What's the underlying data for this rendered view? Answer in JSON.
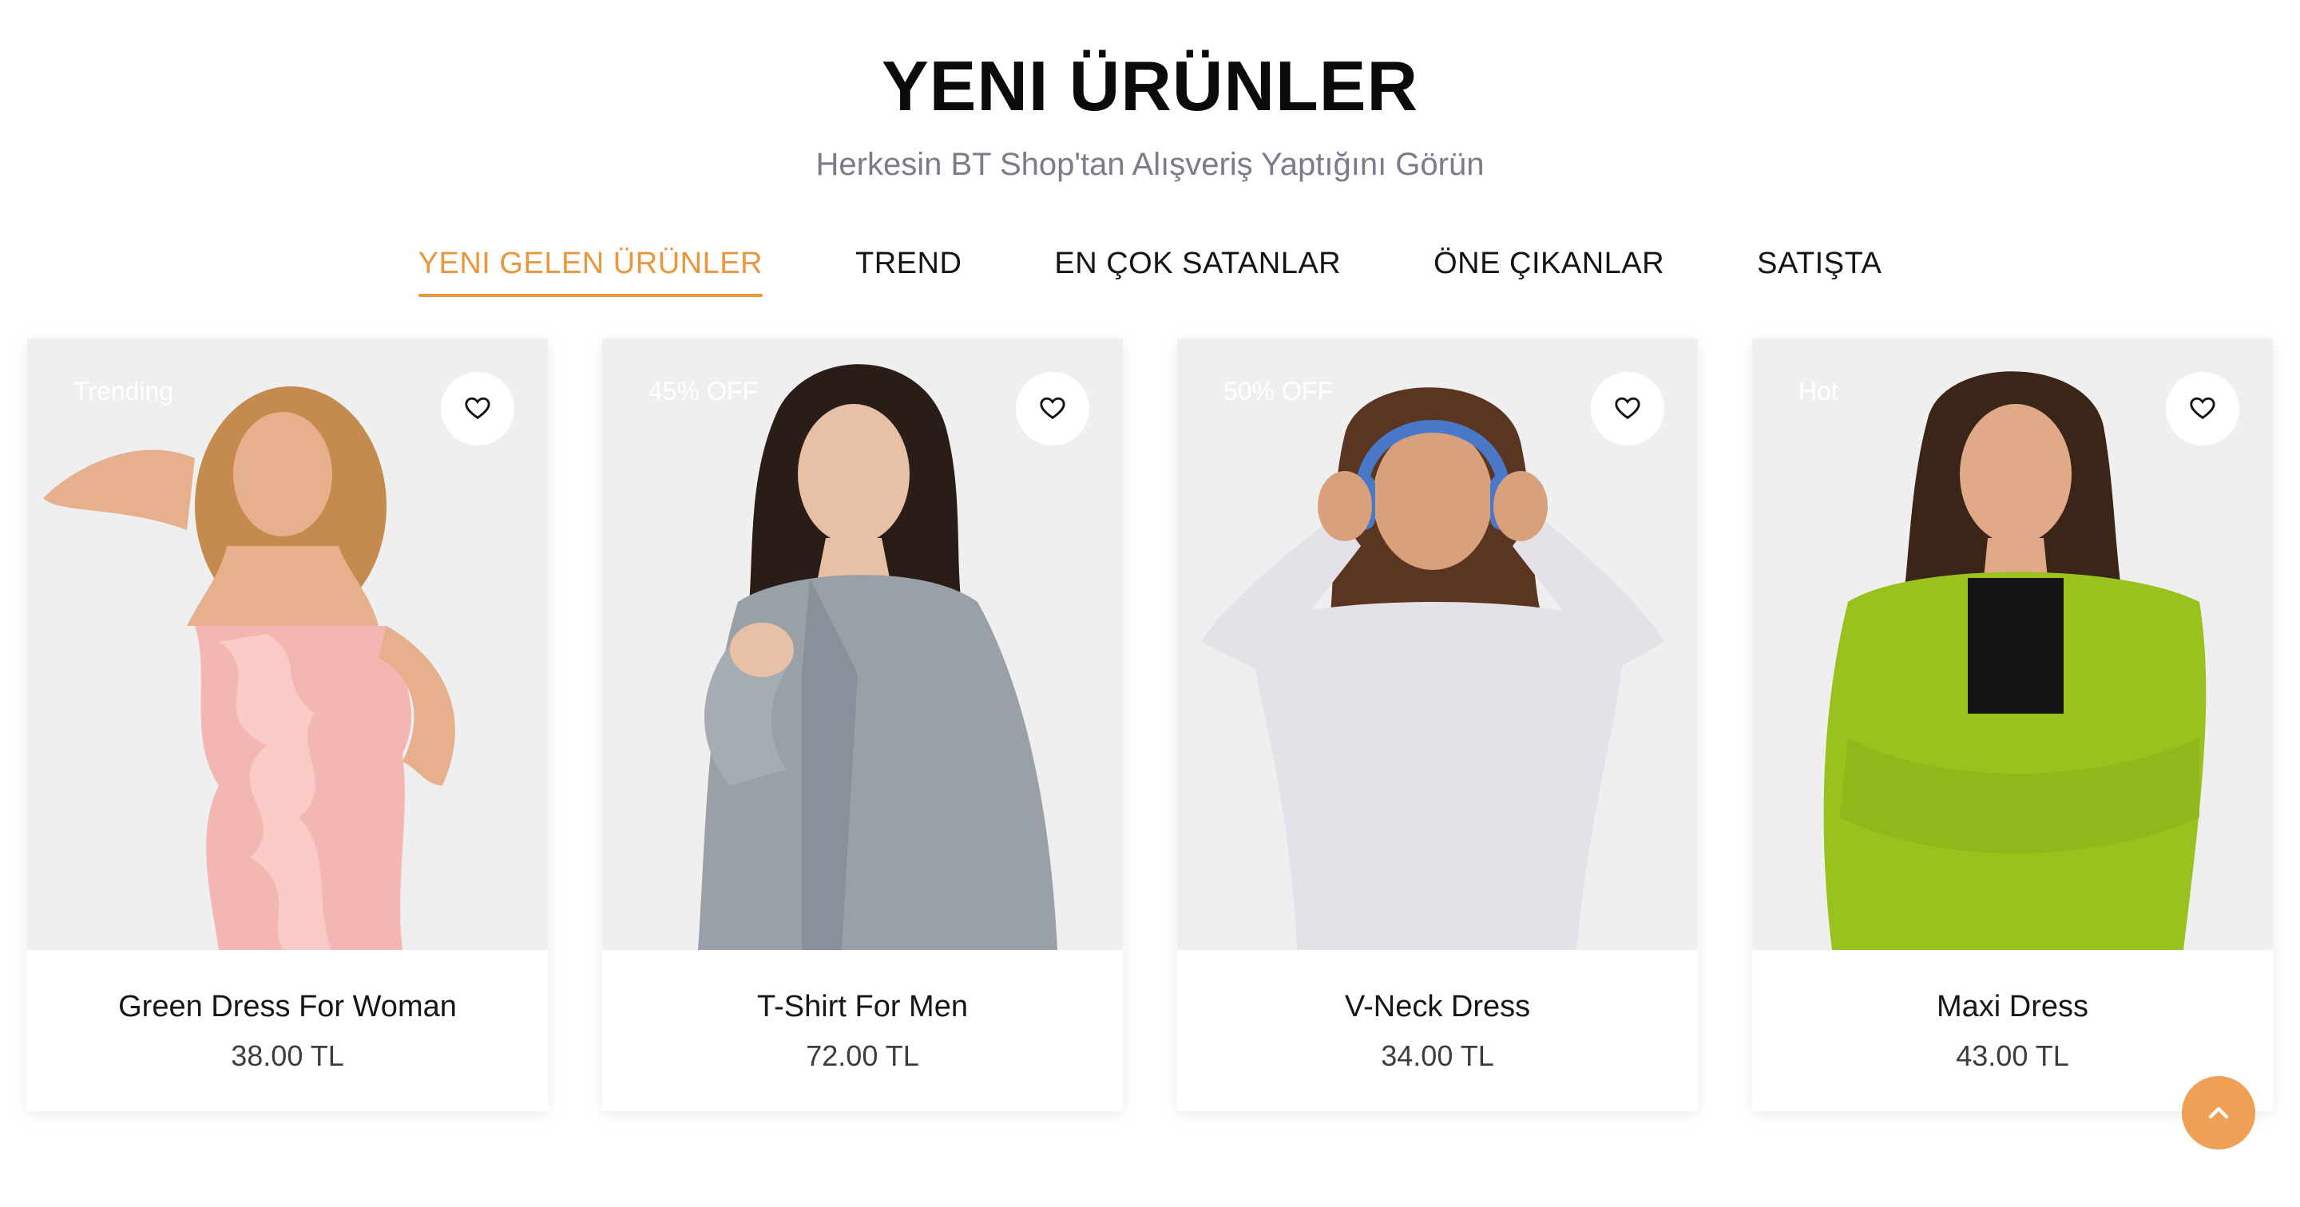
{
  "section": {
    "title": "YENI ÜRÜNLER",
    "subtitle": "Herkesin BT Shop'tan Alışveriş Yaptığını Görün"
  },
  "tabs": [
    {
      "label": "YENI GELEN ÜRÜNLER",
      "active": true
    },
    {
      "label": "TREND",
      "active": false
    },
    {
      "label": "EN ÇOK SATANLAR",
      "active": false
    },
    {
      "label": "ÖNE ÇIKANLAR",
      "active": false
    },
    {
      "label": "SATIŞTA",
      "active": false
    }
  ],
  "products": [
    {
      "badge": "Trending",
      "name": "Green Dress For Woman",
      "price": "38.00 TL",
      "outfit_color": "#f4b6b3",
      "hair_color": "#c58a4e",
      "skin_color": "#e7b08c"
    },
    {
      "badge": "45% OFF",
      "name": "T-Shirt For Men",
      "price": "72.00 TL",
      "outfit_color": "#9aa0a8",
      "hair_color": "#2a1c17",
      "skin_color": "#e8c0a6"
    },
    {
      "badge": "50% OFF",
      "name": "V-Neck Dress",
      "price": "34.00 TL",
      "outfit_color": "#e4e2e8",
      "hair_color": "#5a3522",
      "skin_color": "#d9a07c"
    },
    {
      "badge": "Hot",
      "name": "Maxi Dress",
      "price": "43.00 TL",
      "outfit_color": "#9ac21f",
      "hair_color": "#3b2418",
      "skin_color": "#e0a98a"
    }
  ],
  "icons": {
    "wishlist": "heart-icon",
    "scroll_top": "arrow-up-icon"
  },
  "colors": {
    "accent": "#e9963d",
    "card_media_bg": "#efefef"
  }
}
